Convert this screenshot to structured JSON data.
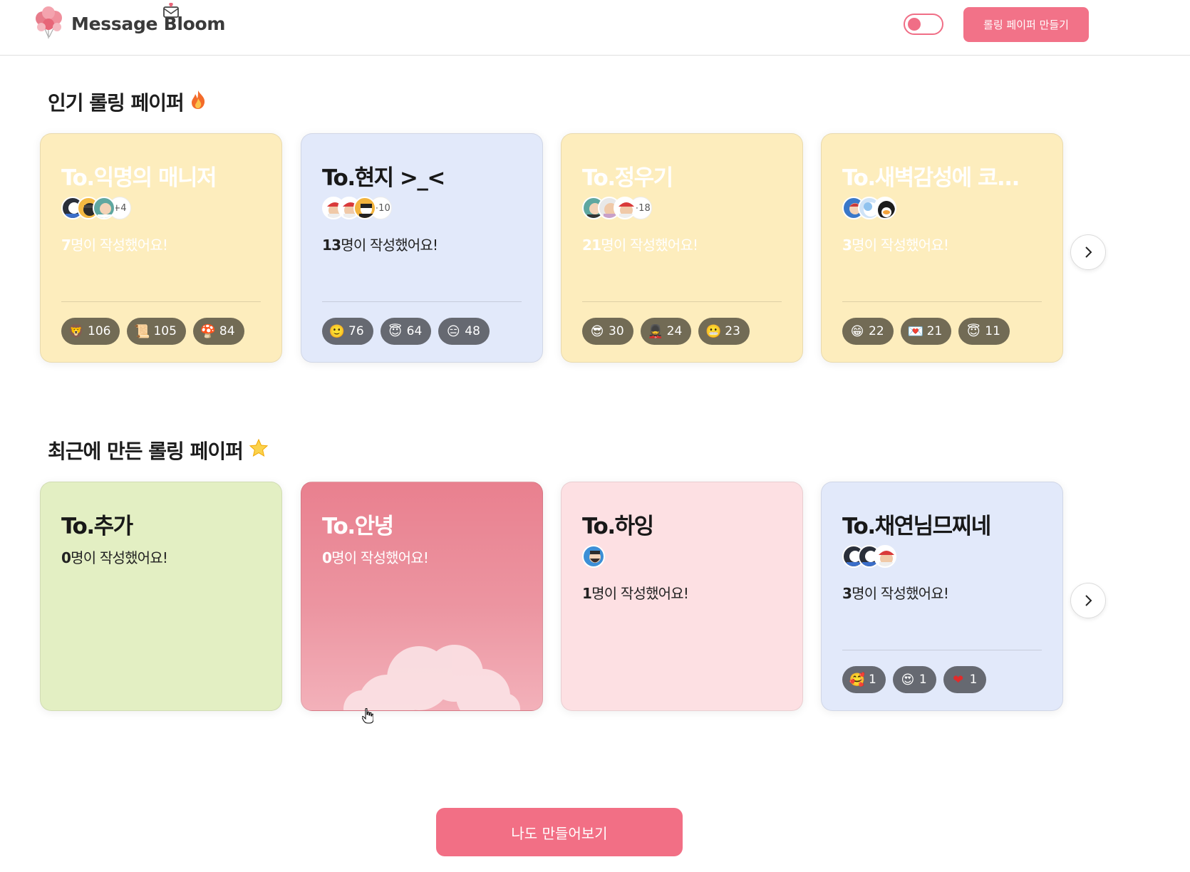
{
  "header": {
    "logo_text": "Message Bloom",
    "create_button": "롤링 페이퍼 만들기",
    "theme_toggle_on": true
  },
  "sections": {
    "popular_title": "인기 롤링 페이퍼",
    "popular_icon": "fire-icon",
    "recent_title": "최근에 만든 롤링 페이퍼",
    "recent_icon": "star-icon"
  },
  "popular_cards": [
    {
      "title": "To.익명의 매니저",
      "count_number": "7",
      "count_suffix": "명이 작성했어요!",
      "more": "+4",
      "reactions": [
        {
          "icon": "lion-emoji",
          "glyph": "🦁",
          "count": "106"
        },
        {
          "icon": "scroll-emoji",
          "glyph": "📜",
          "count": "105"
        },
        {
          "icon": "mushroom-emoji",
          "glyph": "🍄",
          "count": "84"
        }
      ]
    },
    {
      "title": "To.현지 >_<",
      "count_number": "13",
      "count_suffix": "명이 작성했어요!",
      "more": "+10",
      "reactions": [
        {
          "icon": "smile-emoji",
          "glyph": "🙂",
          "count": "76"
        },
        {
          "icon": "halo-emoji",
          "glyph": "😇",
          "count": "64"
        },
        {
          "icon": "expressionless-emoji",
          "glyph": "😑",
          "count": "48"
        }
      ]
    },
    {
      "title": "To.정우기",
      "count_number": "21",
      "count_suffix": "명이 작성했어요!",
      "more": "+18",
      "reactions": [
        {
          "icon": "sunglasses-emoji",
          "glyph": "😎",
          "count": "30"
        },
        {
          "icon": "guard-emoji",
          "glyph": "💂",
          "count": "24"
        },
        {
          "icon": "grimace-emoji",
          "glyph": "😬",
          "count": "23"
        }
      ]
    },
    {
      "title": "To.새벽감성에 코...",
      "count_number": "3",
      "count_suffix": "명이 작성했어요!",
      "more": "",
      "reactions": [
        {
          "icon": "grin-emoji",
          "glyph": "😁",
          "count": "22"
        },
        {
          "icon": "heart-letter-emoji",
          "glyph": "💌",
          "count": "21"
        },
        {
          "icon": "halo-emoji",
          "glyph": "😇",
          "count": "11"
        }
      ]
    }
  ],
  "recent_cards": [
    {
      "title": "To.추가",
      "count_number": "0",
      "count_suffix": "명이 작성했어요!"
    },
    {
      "title": "To.안녕",
      "count_number": "0",
      "count_suffix": "명이 작성했어요!"
    },
    {
      "title": "To.하잉",
      "count_number": "1",
      "count_suffix": "명이 작성했어요!"
    },
    {
      "title": "To.채연님므찌네",
      "count_number": "3",
      "count_suffix": "명이 작성했어요!",
      "reactions": [
        {
          "icon": "hearts-face-emoji",
          "glyph": "🥰",
          "count": "1"
        },
        {
          "icon": "heart-eyes-emoji",
          "glyph": "😍",
          "count": "1"
        },
        {
          "icon": "heart-emoji",
          "glyph": "❤",
          "count": "1"
        }
      ]
    }
  ],
  "cta_button": "나도 만들어보기",
  "colors": {
    "brand": "#f27288",
    "card_yellow": "#fdedbd",
    "card_blue": "#e2e9fa",
    "card_green": "#e3efc3",
    "card_pink": "#fde0e3"
  }
}
